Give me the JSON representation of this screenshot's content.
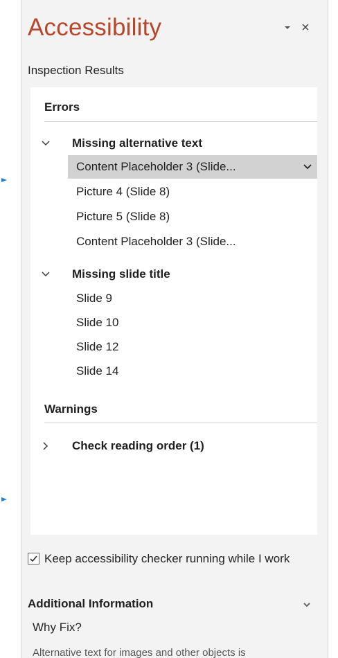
{
  "pane": {
    "title": "Accessibility",
    "subheading": "Inspection Results",
    "close_glyph": "×",
    "menu_icon": "dropdown-arrow-icon"
  },
  "results": {
    "errors_heading": "Errors",
    "groups": [
      {
        "label": "Missing alternative text",
        "expanded": true,
        "items": [
          {
            "label": "Content Placeholder 3  (Slide...",
            "selected": true
          },
          {
            "label": "Picture 4  (Slide 8)"
          },
          {
            "label": "Picture 5  (Slide 8)"
          },
          {
            "label": "Content Placeholder 3  (Slide..."
          }
        ]
      },
      {
        "label": "Missing slide title",
        "expanded": true,
        "items": [
          {
            "label": "Slide 9"
          },
          {
            "label": "Slide 10"
          },
          {
            "label": "Slide 12"
          },
          {
            "label": "Slide 14"
          }
        ]
      }
    ],
    "warnings_heading": "Warnings",
    "warning_groups": [
      {
        "label": "Check reading order (1)",
        "expanded": false
      }
    ]
  },
  "options": {
    "keep_running_label": "Keep accessibility checker running while I work",
    "keep_running_checked": true
  },
  "additional": {
    "heading": "Additional Information",
    "why_fix": "Why Fix?",
    "body_cutoff": "Alternative text for images and other objects is"
  },
  "colors": {
    "title": "#b7472a",
    "pointer_arrow": "#1e7fd6",
    "selection": "#d2d2d2"
  }
}
